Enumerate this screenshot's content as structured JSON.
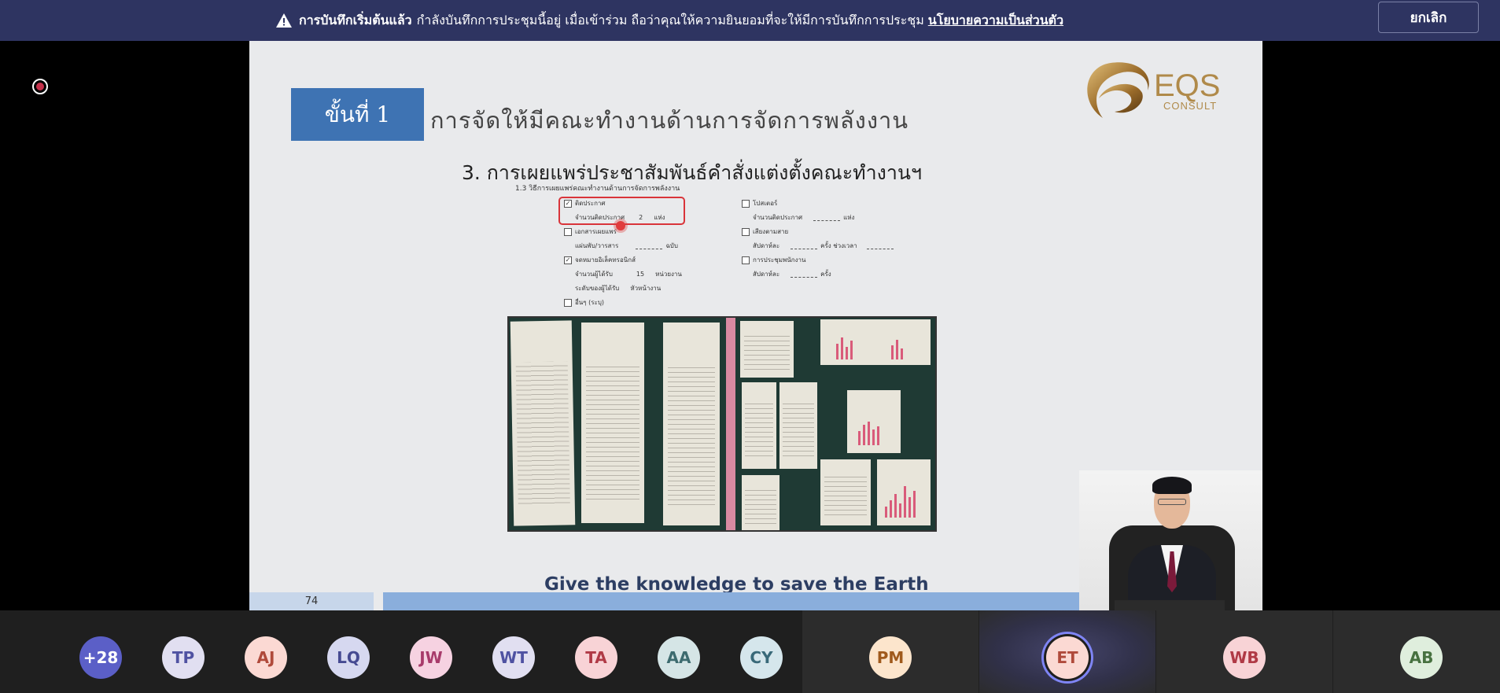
{
  "banner": {
    "strong": "การบันทึกเริ่มต้นแล้ว",
    "message": "กำลังบันทึกการประชุมนี้อยู่ เมื่อเข้าร่วม ถือว่าคุณให้ความยินยอมที่จะให้มีการบันทึกการประชุม",
    "link": "นโยบายความเป็นส่วนตัว",
    "cancel_label": "ยกเลิก"
  },
  "slide": {
    "step_label": "ขั้นที่ 1",
    "title": "การจัดให้มีคณะทำงานด้านการจัดการพลังงาน",
    "logo_text": "EQS",
    "logo_sub": "CONSULT",
    "subheading": "3. การเผยแพร่ประชาสัมพันธ์คำสั่งแต่งตั้งคณะทำงานฯ",
    "form_title": "1.3 วิธีการเผยแพร่คณะทำงานด้านการจัดการพลังงาน",
    "form": {
      "left": [
        {
          "checked": true,
          "label": "ติดประกาศ"
        },
        {
          "checked": null,
          "label": "จำนวนติดประกาศ",
          "value": "2",
          "unit": "แห่ง"
        },
        {
          "checked": false,
          "label": "เอกสารเผยแพร่"
        },
        {
          "checked": null,
          "label": "แผ่นพับ/วารสาร",
          "value": "",
          "unit": "ฉบับ"
        },
        {
          "checked": true,
          "label": "จดหมายอิเล็คทรอนิกส์"
        },
        {
          "checked": null,
          "label": "จำนวนผู้ได้รับ",
          "value": "15",
          "unit": "หน่วยงาน"
        },
        {
          "checked": null,
          "label": "ระดับของผู้ได้รับ",
          "value": "หัวหน้างาน",
          "unit": ""
        },
        {
          "checked": false,
          "label": "อื่นๆ (ระบุ)"
        }
      ],
      "right": [
        {
          "checked": false,
          "label": "โปสเตอร์"
        },
        {
          "checked": null,
          "label": "จำนวนติดประกาศ",
          "value": "",
          "unit": "แห่ง"
        },
        {
          "checked": false,
          "label": "เสียงตามสาย"
        },
        {
          "checked": null,
          "label": "สัปดาห์ละ",
          "value": "",
          "unit": "ครั้ง ช่วงเวลา"
        },
        {
          "checked": false,
          "label": "การประชุมพนักงาน"
        },
        {
          "checked": null,
          "label": "สัปดาห์ละ",
          "value": "",
          "unit": "ครั้ง"
        }
      ]
    },
    "tagline": "Give the knowledge to save the Earth",
    "page_number": "74"
  },
  "participants": [
    {
      "initials": "+28",
      "bg": "#5b5fc7",
      "fg": "#ffffff"
    },
    {
      "initials": "TP",
      "bg": "#e1dff1",
      "fg": "#4f52a2"
    },
    {
      "initials": "AJ",
      "bg": "#fbd9d3",
      "fg": "#b04a3b"
    },
    {
      "initials": "LQ",
      "bg": "#d6d8f0",
      "fg": "#464a92"
    },
    {
      "initials": "JW",
      "bg": "#f6d2e1",
      "fg": "#a83b6b"
    },
    {
      "initials": "WT",
      "bg": "#e1dff1",
      "fg": "#4f52a2"
    },
    {
      "initials": "TA",
      "bg": "#f8d3d6",
      "fg": "#b03a46"
    },
    {
      "initials": "AA",
      "bg": "#d5e5e6",
      "fg": "#3d6b6f"
    },
    {
      "initials": "CY",
      "bg": "#d5e6ec",
      "fg": "#396979"
    },
    {
      "initials": "PM",
      "bg": "#fce5cc",
      "fg": "#a05a1c"
    },
    {
      "initials": "ET",
      "bg": "#fbd9d3",
      "fg": "#b04a3b"
    },
    {
      "initials": "WB",
      "bg": "#f8d3d6",
      "fg": "#b03a46"
    },
    {
      "initials": "AB",
      "bg": "#dfeedd",
      "fg": "#477140"
    }
  ],
  "colors": {
    "banner_bg": "#2e3461",
    "accent": "#5b5fc7",
    "step_box": "#3e73b3",
    "highlight": "#d9343a"
  }
}
